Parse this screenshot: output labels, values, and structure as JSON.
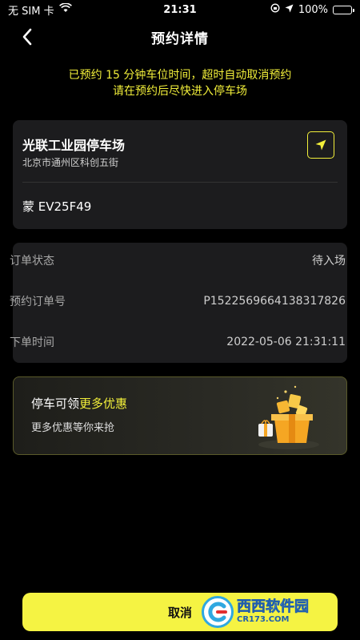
{
  "status_bar": {
    "carrier": "无 SIM 卡",
    "time": "21:31",
    "battery": "100%",
    "icons": [
      "wifi-icon",
      "rotation-lock-icon",
      "location-arrow-icon",
      "battery-icon"
    ]
  },
  "nav": {
    "title": "预约详情",
    "back_icon": "chevron-left-icon"
  },
  "notice": {
    "line1": "已预约 15 分钟车位时间，超时自动取消预约",
    "line2": "请在预约后尽快进入停车场"
  },
  "parking": {
    "name": "光联工业园停车场",
    "address": "北京市通州区科创五街",
    "plate": "蒙 EV25F49",
    "navigate_icon": "navigation-arrow-icon"
  },
  "order": {
    "rows": [
      {
        "label": "订单状态",
        "value": "待入场"
      },
      {
        "label": "预约订单号",
        "value": "P1522569664138317826"
      },
      {
        "label": "下单时间",
        "value": "2022-05-06 21:31:11"
      }
    ]
  },
  "promo": {
    "title_prefix": "停车可领",
    "title_highlight": "更多优惠",
    "subtitle": "更多优惠等你来抢",
    "icon": "gift-box-icon"
  },
  "actions": {
    "cancel_label": "取消"
  },
  "watermark": {
    "cn_a": "西西",
    "cn_b": "软件园",
    "url": "CR173.COM"
  },
  "colors": {
    "accent": "#f5f343",
    "background": "#000000",
    "card": "#1c1c1e"
  }
}
